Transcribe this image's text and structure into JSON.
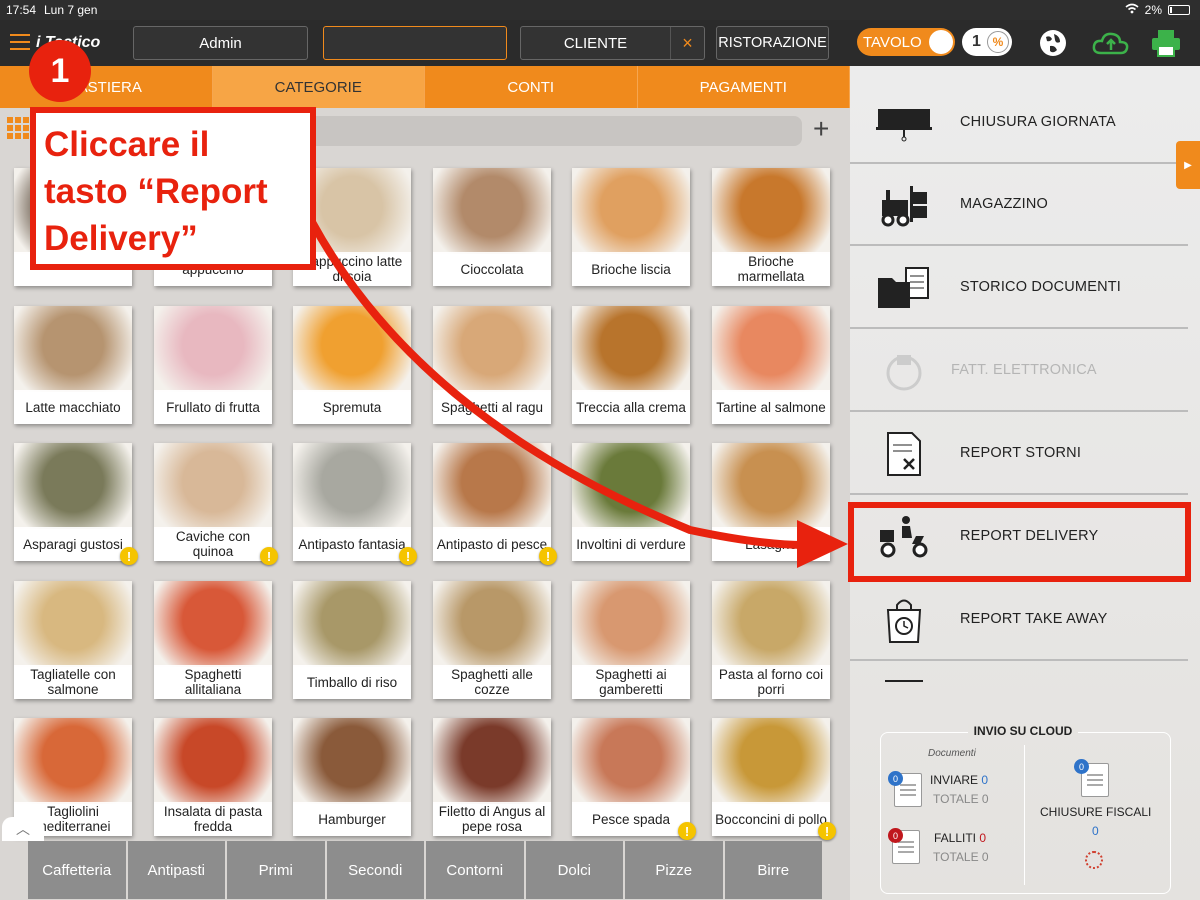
{
  "status": {
    "time": "17:54",
    "date": "Lun 7 gen",
    "battery": "2%"
  },
  "topbar": {
    "logo": "i Tactico",
    "user": "Admin",
    "center_field": "",
    "cliente": "CLIENTE",
    "cliente_clear": "×",
    "mode": "RISTORAZIONE",
    "tavolo": "TAVOLO",
    "coperti": "1",
    "coperti_pct": "%"
  },
  "tabs": [
    {
      "label": "TASTIERA"
    },
    {
      "label": "CATEGORIE"
    },
    {
      "label": "CONTI"
    },
    {
      "label": "PAGAMENTI"
    }
  ],
  "products": [
    {
      "name": "",
      "color": "#5a4a3a",
      "warn": false
    },
    {
      "name": "appuccino",
      "color": "#c4a27a",
      "warn": false
    },
    {
      "name": "Cappuccino latte di soia",
      "color": "#d8c4a6",
      "warn": false
    },
    {
      "name": "Cioccolata",
      "color": "#b28a6a",
      "warn": false
    },
    {
      "name": "Brioche liscia",
      "color": "#e0a060",
      "warn": false
    },
    {
      "name": "Brioche marmellata",
      "color": "#c8782c",
      "warn": false
    },
    {
      "name": "Latte macchiato",
      "color": "#b69470",
      "warn": false
    },
    {
      "name": "Frullato di frutta",
      "color": "#e8b8c0",
      "warn": false
    },
    {
      "name": "Spremuta",
      "color": "#f0a030",
      "warn": false
    },
    {
      "name": "Spaghetti al ragu",
      "color": "#d8a878",
      "warn": false
    },
    {
      "name": "Treccia alla crema",
      "color": "#b8742c",
      "warn": false
    },
    {
      "name": "Tartine al salmone",
      "color": "#e88860",
      "warn": false
    },
    {
      "name": "Asparagi gustosi",
      "color": "#7a7a5a",
      "warn": true
    },
    {
      "name": "Caviche con quinoa",
      "color": "#d8b898",
      "warn": true
    },
    {
      "name": "Antipasto fantasia",
      "color": "#a8a8a0",
      "warn": true
    },
    {
      "name": "Antipasto di pesce",
      "color": "#b8784a",
      "warn": true
    },
    {
      "name": "Involtini di verdure",
      "color": "#6a7a3a",
      "warn": false
    },
    {
      "name": "Lasagne",
      "color": "#c89050",
      "warn": false
    },
    {
      "name": "Tagliatelle con salmone",
      "color": "#d8b880",
      "warn": false
    },
    {
      "name": "Spaghetti allitaliana",
      "color": "#d85838",
      "warn": false
    },
    {
      "name": "Timballo di riso",
      "color": "#a89868",
      "warn": false
    },
    {
      "name": "Spaghetti alle cozze",
      "color": "#b89868",
      "warn": false
    },
    {
      "name": "Spaghetti ai gamberetti",
      "color": "#d89870",
      "warn": false
    },
    {
      "name": "Pasta al forno coi porri",
      "color": "#c8a868",
      "warn": false
    },
    {
      "name": "Tagliolini mediterranei",
      "color": "#d86838",
      "warn": false
    },
    {
      "name": "Insalata di pasta fredda",
      "color": "#c84828",
      "warn": false
    },
    {
      "name": "Hamburger",
      "color": "#8a5a3a",
      "warn": false
    },
    {
      "name": "Filetto di Angus al pepe rosa",
      "color": "#7a3a2a",
      "warn": false
    },
    {
      "name": "Pesce spada",
      "color": "#c87858",
      "warn": true
    },
    {
      "name": "Bocconcini di pollo",
      "color": "#c89838",
      "warn": true
    }
  ],
  "categories": [
    {
      "label": "Caffetteria"
    },
    {
      "label": "Antipasti"
    },
    {
      "label": "Primi"
    },
    {
      "label": "Secondi"
    },
    {
      "label": "Contorni"
    },
    {
      "label": "Dolci"
    },
    {
      "label": "Pizze"
    },
    {
      "label": "Birre"
    }
  ],
  "panel": {
    "items": [
      {
        "label": "CHIUSURA GIORNATA",
        "icon": "register-icon",
        "disabled": false
      },
      {
        "label": "MAGAZZINO",
        "icon": "forklift-icon",
        "disabled": false
      },
      {
        "label": "STORICO DOCUMENTI",
        "icon": "folder-docs-icon",
        "disabled": false
      },
      {
        "label": "FATT. ELETTRONICA",
        "icon": "einvoice-icon",
        "disabled": true
      },
      {
        "label": "REPORT STORNI",
        "icon": "document-x-icon",
        "disabled": false
      },
      {
        "label": "REPORT DELIVERY",
        "icon": "scooter-icon",
        "disabled": false
      },
      {
        "label": "REPORT TAKE AWAY",
        "icon": "shopping-bag-24h-icon",
        "disabled": false
      }
    ],
    "cloud": {
      "title": "INVIO SU CLOUD",
      "documenti": "Documenti",
      "inviare_label": "INVIARE",
      "inviare_value": "0",
      "totale_label": "TOTALE",
      "totale_value": "0",
      "inviare_badge": "0",
      "falliti_label": "FALLITI",
      "falliti_value": "0",
      "falliti_totale_label": "TOTALE",
      "falliti_totale_value": "0",
      "falliti_badge": "0",
      "chiusure_label": "CHIUSURE FISCALI",
      "chiusure_value": "0",
      "chiusure_badge": "0"
    }
  },
  "annotation": {
    "step": "1",
    "text": "Cliccare il tasto “Report Delivery”"
  },
  "colors": {
    "accent": "#f08a1c",
    "annotation": "#e8220e",
    "dark": "#2b2b2b"
  }
}
